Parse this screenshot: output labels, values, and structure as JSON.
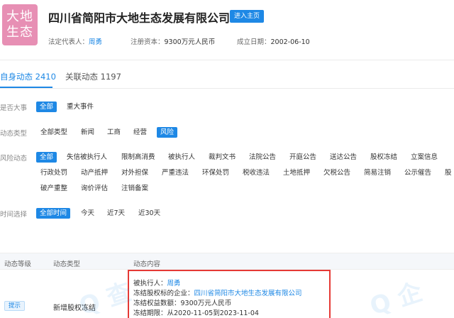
{
  "header": {
    "logo_text_line1": "大地",
    "logo_text_line2": "生态",
    "company_name": "四川省简阳市大地生态发展有限公司",
    "home_button": "进入主页",
    "legal_rep_label": "法定代表人：",
    "legal_rep_value": "周勇",
    "capital_label": "注册资本：",
    "capital_value": "9300万元人民币",
    "founded_label": "成立日期：",
    "founded_value": "2002-06-10"
  },
  "tabs": [
    {
      "label": "自身动态 2410",
      "active": true
    },
    {
      "label": "关联动态 1197",
      "active": false
    }
  ],
  "filters": {
    "major": {
      "label": "是否大事",
      "options": [
        "全部",
        "重大事件"
      ]
    },
    "type": {
      "label": "动态类型",
      "options": [
        "全部类型",
        "新闻",
        "工商",
        "经营",
        "风险"
      ]
    },
    "risk": {
      "label": "风险动态",
      "row1": [
        "全部",
        "失信被执行人",
        "限制高消费",
        "被执行人",
        "裁判文书",
        "法院公告",
        "开庭公告",
        "送达公告",
        "股权冻结",
        "立案信息"
      ],
      "row2": [
        "行政处罚",
        "动产抵押",
        "对外担保",
        "严重违法",
        "环保处罚",
        "税收违法",
        "土地抵押",
        "欠税公告",
        "简易注销",
        "公示催告",
        "股"
      ],
      "row3": [
        "破产重整",
        "询价评估",
        "注销备案"
      ]
    },
    "time": {
      "label": "时间选择",
      "options": [
        "全部时间",
        "今天",
        "近7天",
        "近30天"
      ]
    }
  },
  "table": {
    "headers": [
      "动态等级",
      "动态类型",
      "动态内容"
    ],
    "row": {
      "level": "提示",
      "type": "新增股权冻结",
      "executee_label": "被执行人：",
      "executee_value": "周勇",
      "target_label": "冻结股权标的企业：",
      "target_value": "四川省简阳市大地生态发展有限公司",
      "amount_label": "冻结权益数额：",
      "amount_value": "9300万元人民币",
      "period_label": "冻结期限：",
      "period_value": "从2020-11-05到2023-11-04"
    }
  },
  "colors": {
    "accent": "#1e88e5",
    "highlight_border": "#e53935",
    "logo_bg": "#e78fb4"
  }
}
